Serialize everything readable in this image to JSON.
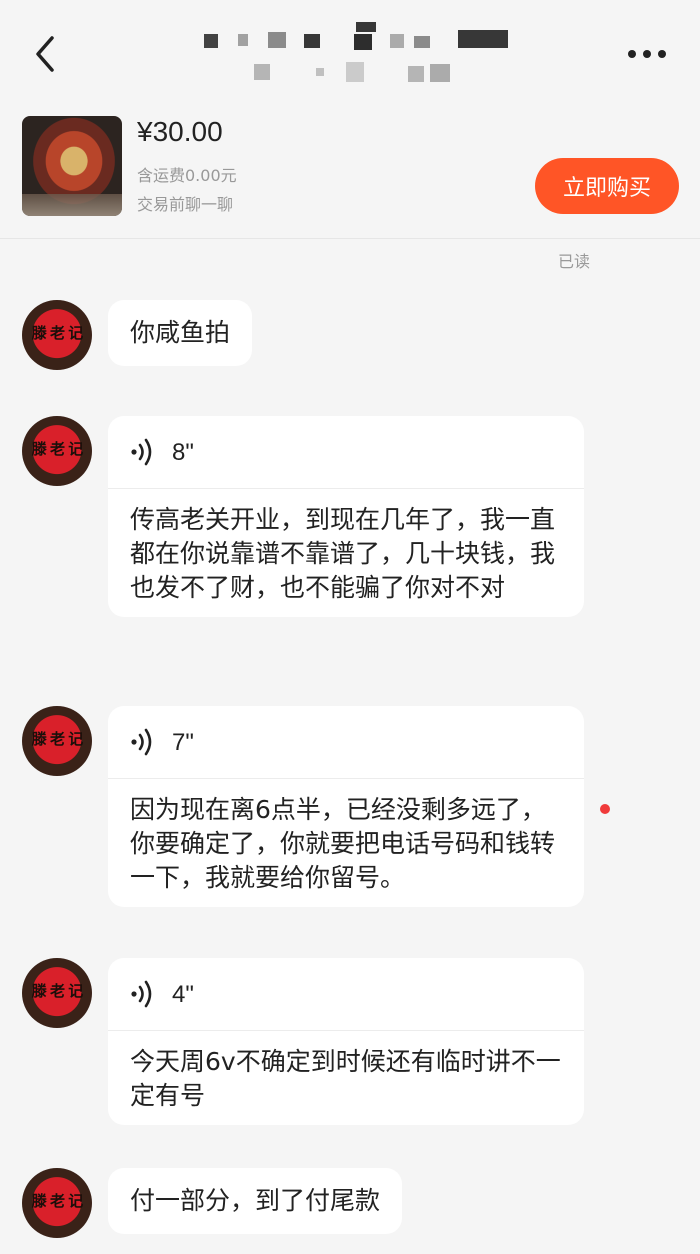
{
  "header": {
    "back_icon": "chevron-left-icon",
    "title_blurred": true,
    "more_icon": "more-horizontal-icon"
  },
  "product": {
    "price": "¥30.00",
    "shipping": "含运费0.00元",
    "chat_note": "交易前聊一聊",
    "buy_label": "立即购买",
    "buy_color": "#ff5526"
  },
  "read_status": "已读",
  "avatar_text": "",
  "messages": [
    {
      "type": "text",
      "text": "你咸鱼拍"
    },
    {
      "type": "voice",
      "duration": "8\"",
      "transcript": "传高老关开业，到现在几年了，我一直都在你说靠谱不靠谱了，几十块钱，我也发不了财，也不能骗了你对不对"
    },
    {
      "type": "voice",
      "duration": "7\"",
      "transcript": "因为现在离6点半，已经没剩多远了，你要确定了，你就要把电话号码和钱转一下，我就要给你留号。",
      "unread": true
    },
    {
      "type": "voice",
      "duration": "4\"",
      "transcript": "今天周6v不确定到时候还有临时讲不一定有号"
    },
    {
      "type": "text",
      "text": "付一部分，到了付尾款"
    }
  ],
  "colors": {
    "background": "#f5f5f5",
    "bubble": "#ffffff",
    "unread_dot": "#f03a3a"
  }
}
